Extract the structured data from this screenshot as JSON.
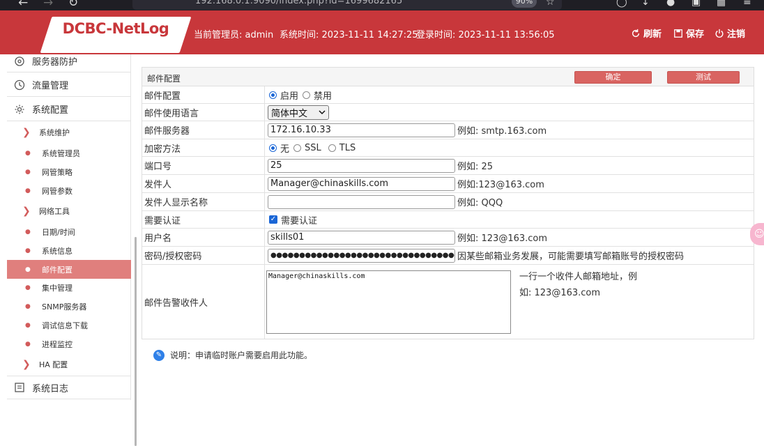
{
  "browser": {
    "url": "192.168.0.1:9090/index.php?id=1699682165",
    "zoom": "90%"
  },
  "header": {
    "logo": "DCBC-NetLog",
    "admin_label": "当前管理员: admin",
    "system_time": "系统时间: 2023-11-11 14:27:25",
    "login_time": "登录时间: 2023-11-11 13:56:05",
    "refresh": "刷新",
    "save": "保存",
    "logout": "注销"
  },
  "sidebar": {
    "main": [
      {
        "label": "服务器防护",
        "icon": "server-protect-icon"
      },
      {
        "label": "流量管理",
        "icon": "clock-icon"
      },
      {
        "label": "系统配置",
        "icon": "gear-icon"
      },
      {
        "label": "系统日志",
        "icon": "log-icon"
      }
    ],
    "sub": [
      {
        "label": "系统维护",
        "marker": "chevron"
      },
      {
        "label": "系统管理员",
        "marker": "dot"
      },
      {
        "label": "网管策略",
        "marker": "dot"
      },
      {
        "label": "网管参数",
        "marker": "dot"
      },
      {
        "label": "网络工具",
        "marker": "chevron"
      },
      {
        "label": "日期/时间",
        "marker": "dot"
      },
      {
        "label": "系统信息",
        "marker": "dot"
      },
      {
        "label": "邮件配置",
        "marker": "dot",
        "active": true
      },
      {
        "label": "集中管理",
        "marker": "dot"
      },
      {
        "label": "SNMP服务器",
        "marker": "dot"
      },
      {
        "label": "调试信息下载",
        "marker": "dot"
      },
      {
        "label": "进程监控",
        "marker": "dot"
      },
      {
        "label": "HA 配置",
        "marker": "chevron"
      }
    ]
  },
  "panel": {
    "title": "邮件配置",
    "confirm": "确定",
    "test": "测试"
  },
  "form": {
    "mail_config": {
      "label": "邮件配置",
      "opt_enable": "启用",
      "opt_disable": "禁用",
      "selected": "启用"
    },
    "language": {
      "label": "邮件使用语言",
      "value": "简体中文"
    },
    "server": {
      "label": "邮件服务器",
      "value": "172.16.10.33",
      "hint": "例如: smtp.163.com"
    },
    "encryption": {
      "label": "加密方法",
      "opt_none": "无",
      "opt_ssl": "SSL",
      "opt_tls": "TLS",
      "selected": "无"
    },
    "port": {
      "label": "端口号",
      "value": "25",
      "hint": "例如: 25"
    },
    "sender": {
      "label": "发件人",
      "value": "Manager@chinaskills.com",
      "hint": "例如:123@163.com"
    },
    "sender_name": {
      "label": "发件人显示名称",
      "value": "",
      "hint": "例如: QQQ"
    },
    "auth": {
      "label": "需要认证",
      "check_label": "需要认证",
      "checked": true
    },
    "username": {
      "label": "用户名",
      "value": "skills01",
      "hint": "例如: 123@163.com"
    },
    "password": {
      "label": "密码/授权密码",
      "value": "●●●●●●●●●●●●●●●●●●●●●●●●●●●●●●●●●",
      "hint": "因某些邮箱业务发展，可能需要填写邮箱账号的授权密码"
    },
    "recipients": {
      "label": "邮件告警收件人",
      "value": "Manager@chinaskills.com",
      "hint_line1": "一行一个收件人邮箱地址，例",
      "hint_line2": "如: 123@163.com"
    }
  },
  "note": "说明：申请临时账户需要启用此功能。",
  "colors": {
    "header_red": "#c8373b",
    "accent_red": "#d96461",
    "active_sidebar": "#e07f7d"
  }
}
